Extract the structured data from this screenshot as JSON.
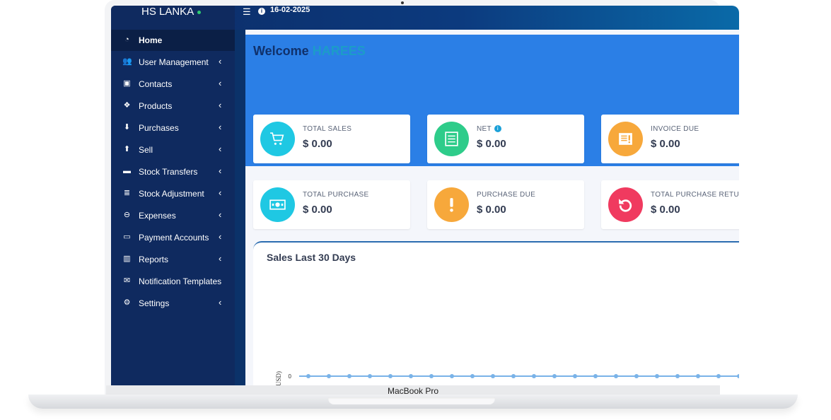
{
  "app": {
    "brand": "HS LANKA",
    "date": "16-02-2025"
  },
  "sidebar": {
    "items": [
      {
        "label": "Home",
        "icon": "dashboard-icon",
        "active": true
      },
      {
        "label": "User Management",
        "icon": "users-icon",
        "chevron": true
      },
      {
        "label": "Contacts",
        "icon": "address-book-icon",
        "chevron": true
      },
      {
        "label": "Products",
        "icon": "cubes-icon",
        "chevron": true
      },
      {
        "label": "Purchases",
        "icon": "arrow-circle-down-icon",
        "chevron": true
      },
      {
        "label": "Sell",
        "icon": "arrow-circle-up-icon",
        "chevron": true
      },
      {
        "label": "Stock Transfers",
        "icon": "truck-icon",
        "chevron": true
      },
      {
        "label": "Stock Adjustment",
        "icon": "database-icon",
        "chevron": true
      },
      {
        "label": "Expenses",
        "icon": "minus-circle-icon",
        "chevron": true
      },
      {
        "label": "Payment Accounts",
        "icon": "money-check-icon",
        "chevron": true
      },
      {
        "label": "Reports",
        "icon": "bar-chart-icon",
        "chevron": true
      },
      {
        "label": "Notification Templates",
        "icon": "envelope-icon",
        "chevron": false
      },
      {
        "label": "Settings",
        "icon": "gear-icon",
        "chevron": true
      }
    ],
    "chevron_glyph": "‹"
  },
  "header": {
    "welcome_prefix": "Welcome",
    "user": "HAREES"
  },
  "cards": [
    {
      "title": "TOTAL SALES",
      "value": "$ 0.00",
      "icon": "cart-icon",
      "color": "#1fc8e3"
    },
    {
      "title": "NET",
      "value": "$ 0.00",
      "icon": "document-icon",
      "color": "#2ecc8a"
    },
    {
      "title": "INVOICE DUE",
      "value": "$ 0.00",
      "icon": "invoice-warning-icon",
      "color": "#f7a83b"
    },
    {
      "title": "TOTAL PURCHASE",
      "value": "$ 0.00",
      "icon": "money-icon",
      "color": "#1fc8e3"
    },
    {
      "title": "PURCHASE DUE",
      "value": "$ 0.00",
      "icon": "exclamation-icon",
      "color": "#f7a83b"
    },
    {
      "title": "TOTAL PURCHASE RETURN",
      "value": "$ 0.00",
      "icon": "undo-icon",
      "color": "#f03a5f"
    }
  ],
  "chart": {
    "title": "Sales Last 30 Days",
    "ylabel": "ales (USD)",
    "ytick": "0"
  },
  "chart_data": {
    "type": "line",
    "title": "Sales Last 30 Days",
    "ylabel": "ales (USD)",
    "y_ticks": [
      "0"
    ],
    "series": [
      {
        "values": [
          0,
          0,
          0,
          0,
          0,
          0,
          0,
          0,
          0,
          0,
          0,
          0,
          0,
          0,
          0,
          0,
          0,
          0,
          0,
          0,
          0,
          0
        ]
      }
    ],
    "color": "#7ab3e8"
  },
  "device": {
    "label": "MacBook Pro"
  }
}
